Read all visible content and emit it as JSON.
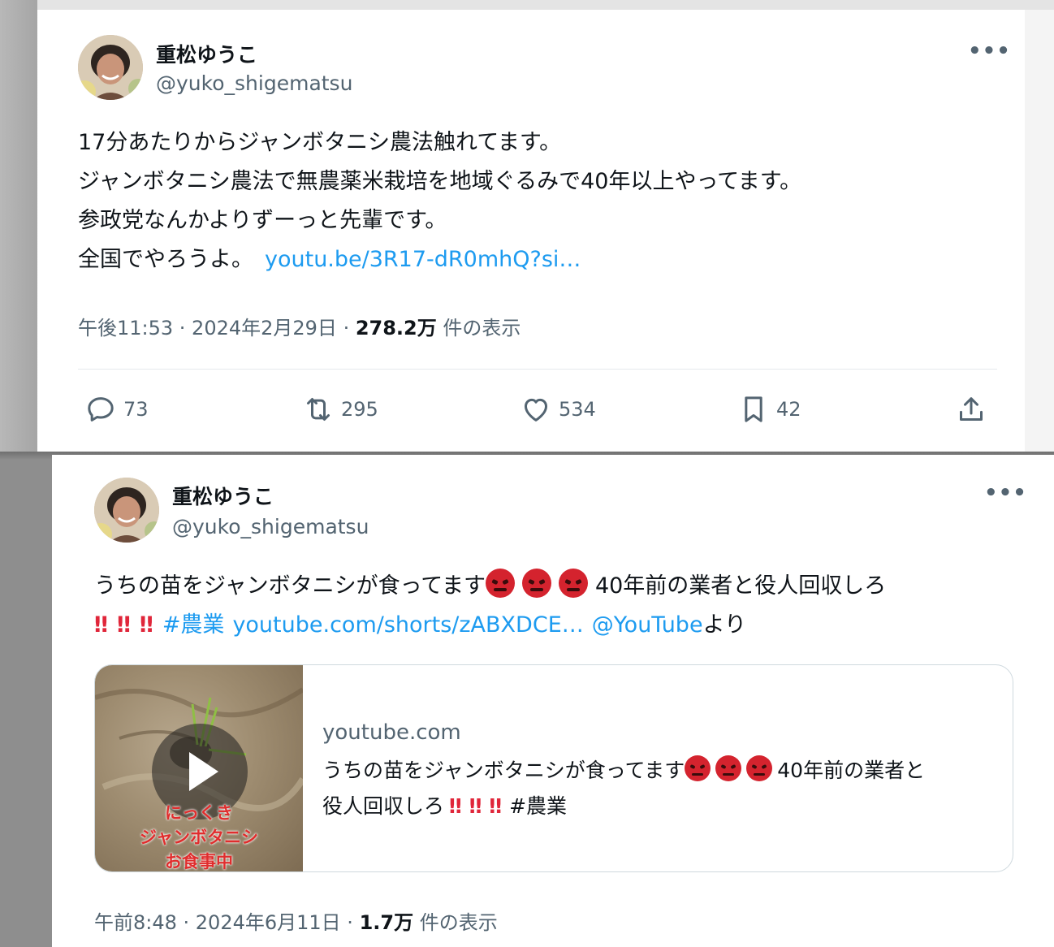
{
  "tweets": [
    {
      "name": "重松ゆうこ",
      "handle": "@yuko_shigematsu",
      "more": "•••",
      "lines": [
        "17分あたりからジャンボタニシ農法触れてます。",
        "ジャンボタニシ農法で無農薬米栽培を地域ぐるみで40年以上やってます。",
        "参政党なんかよりずーっと先輩です。",
        "全国でやろうよ。"
      ],
      "link": "youtu.be/3R17-dR0mhQ?si…",
      "time": "午後11:53 · 2024年2月29日 · ",
      "views": "278.2万",
      "views_suffix": " 件の表示",
      "actions": {
        "reply": "73",
        "retweet": "295",
        "like": "534",
        "bookmark": "42"
      }
    },
    {
      "name": "重松ゆうこ",
      "handle": "@yuko_shigematsu",
      "more": "•••",
      "text_a": "うちの苗をジャンボタニシが食ってます",
      "text_b": "40年前の業者と役人回収しろ",
      "bang": "‼",
      "hashtag": "#農業",
      "link": "youtube.com/shorts/zABXDCE…",
      "mention": "@YouTube",
      "mention_suffix": "より",
      "card": {
        "domain": "youtube.com",
        "text_a": "うちの苗をジャンボタニシが食ってます",
        "text_b": "40年前の業者と",
        "text_c": "役人回収しろ",
        "hashtag": "#農業",
        "thumb_caption": [
          "にっくき",
          "ジャンボタニシ",
          "お食事中"
        ]
      },
      "time": "午前8:48 · 2024年6月11日 · ",
      "views": "1.7万",
      "views_suffix": " 件の表示"
    }
  ],
  "icons": {
    "emoji": "pouting-face-emoji",
    "bang": "double-exclamation-emoji",
    "reply": "reply-icon",
    "retweet": "retweet-icon",
    "like": "heart-icon",
    "bookmark": "bookmark-icon",
    "share": "share-icon",
    "play": "play-icon"
  },
  "colors": {
    "link": "#1d9bf0",
    "secondary_text": "#536471",
    "primary_text": "#0f1419",
    "emoji_red": "#d4232e"
  }
}
